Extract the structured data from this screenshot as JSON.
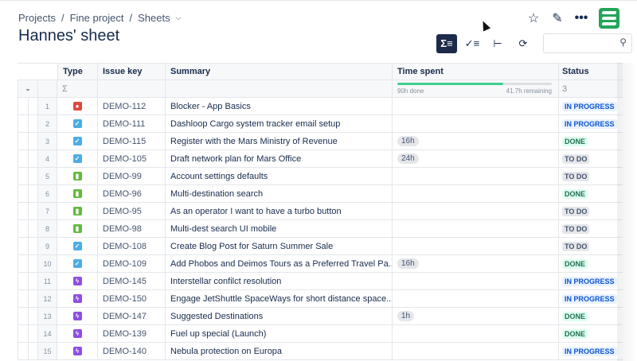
{
  "breadcrumb": [
    "Projects",
    "Fine project",
    "Sheets"
  ],
  "title": "Hannes' sheet",
  "search": {
    "placeholder": "",
    "value": ""
  },
  "columns": [
    "Type",
    "Issue key",
    "Summary",
    "Time spent",
    "Status"
  ],
  "summary_row": {
    "sigma": "Σ",
    "time_done": "90h done",
    "time_remaining": "41.7h remaining",
    "progress_fraction": 0.683,
    "status_count": "3"
  },
  "colors": {
    "accent": "#1d2b4a",
    "brand": "#22a559",
    "progress": "#3ecf8e"
  },
  "rows": [
    {
      "n": "1",
      "type": "bug",
      "key": "DEMO-112",
      "summary": "Blocker - App Basics",
      "time": "",
      "status": "IN PROGRESS"
    },
    {
      "n": "2",
      "type": "task",
      "key": "DEMO-111",
      "summary": "Dashloop Cargo system tracker email setup",
      "time": "",
      "status": "IN PROGRESS"
    },
    {
      "n": "3",
      "type": "task",
      "key": "DEMO-115",
      "summary": "Register with the Mars Ministry of Revenue",
      "time": "16h",
      "status": "DONE"
    },
    {
      "n": "4",
      "type": "task",
      "key": "DEMO-105",
      "summary": "Draft network plan for Mars Office",
      "time": "24h",
      "status": "TO DO"
    },
    {
      "n": "5",
      "type": "story",
      "key": "DEMO-99",
      "summary": "Account settings defaults",
      "time": "",
      "status": "TO DO"
    },
    {
      "n": "6",
      "type": "story",
      "key": "DEMO-96",
      "summary": "Multi-destination search",
      "time": "",
      "status": "DONE"
    },
    {
      "n": "7",
      "type": "story",
      "key": "DEMO-95",
      "summary": "As an operator I want to have a turbo button",
      "time": "",
      "status": "TO DO"
    },
    {
      "n": "8",
      "type": "story",
      "key": "DEMO-98",
      "summary": "Multi-dest search UI mobile",
      "time": "",
      "status": "TO DO"
    },
    {
      "n": "9",
      "type": "task",
      "key": "DEMO-108",
      "summary": "Create Blog Post for Saturn Summer Sale",
      "time": "",
      "status": "TO DO"
    },
    {
      "n": "10",
      "type": "task",
      "key": "DEMO-109",
      "summary": "Add Phobos and Deimos Tours as a Preferred Travel Pa...",
      "time": "16h",
      "status": "DONE"
    },
    {
      "n": "11",
      "type": "epic",
      "key": "DEMO-145",
      "summary": "Interstellar confilct resolution",
      "time": "",
      "status": "IN PROGRESS"
    },
    {
      "n": "12",
      "type": "epic",
      "key": "DEMO-150",
      "summary": "Engage JetShuttle SpaceWays for short distance space...",
      "time": "",
      "status": "IN PROGRESS"
    },
    {
      "n": "13",
      "type": "epic",
      "key": "DEMO-147",
      "summary": "Suggested Destinations",
      "time": "1h",
      "status": "DONE"
    },
    {
      "n": "14",
      "type": "epic",
      "key": "DEMO-139",
      "summary": "Fuel up special (Launch)",
      "time": "",
      "status": "DONE"
    },
    {
      "n": "15",
      "type": "epic",
      "key": "DEMO-140",
      "summary": "Nebula protection on Europa",
      "time": "",
      "status": "IN PROGRESS"
    }
  ]
}
